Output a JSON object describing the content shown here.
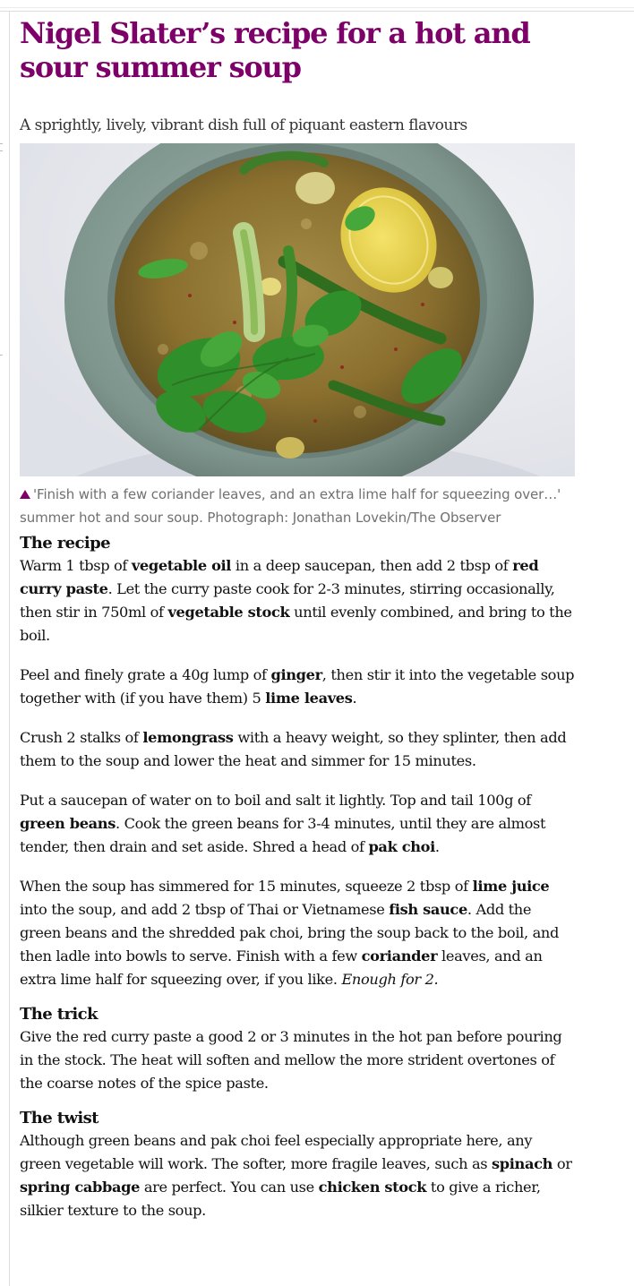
{
  "article": {
    "headline": "Nigel Slater’s recipe for a hot and sour summer soup",
    "standfirst": "A sprightly, lively, vibrant dish full of piquant eastern flavours",
    "image_alt": "Bowl of hot and sour summer soup with coriander, green beans, pak choi and lime half",
    "caption": "'Finish with a few coriander leaves, and an extra lime half for squeezing over…' summer hot and sour soup. Photograph: Jonathan Lovekin/The Observer"
  },
  "recipe": {
    "heading": "The recipe",
    "p1": {
      "t1": "Warm 1 tbsp of ",
      "b1": "vegetable oil",
      "t2": " in a deep saucepan, then add 2 tbsp of ",
      "b2": "red curry paste",
      "t3": ". Let the curry paste cook for 2-3 minutes, stirring occasionally, then stir in 750ml of ",
      "b3": "vegetable stock",
      "t4": " until evenly combined, and bring to the boil."
    },
    "p2": {
      "t1": "Peel and finely grate a 40g lump of ",
      "b1": "ginger",
      "t2": ", then stir it into the vegetable soup together with (if you have them) 5 ",
      "b2": "lime leaves",
      "t3": "."
    },
    "p3": {
      "t1": "Crush 2 stalks of ",
      "b1": "lemongrass",
      "t2": " with a heavy weight, so they splinter, then add them to the soup and lower the heat and simmer for 15 minutes."
    },
    "p4": {
      "t1": "Put a saucepan of water on to boil and salt it lightly. Top and tail 100g of ",
      "b1": "green beans",
      "t2": ". Cook the green beans for 3-4 minutes, until they are almost tender, then drain and set aside. Shred a head of ",
      "b2": "pak choi",
      "t3": "."
    },
    "p5": {
      "t1": "When the soup has simmered for 15 minutes, squeeze 2 tbsp of ",
      "b1": "lime juice",
      "t2": " into the soup, and add 2 tbsp of Thai or Vietnamese ",
      "b2": "fish sauce",
      "t3": ". Add the green beans and the shredded pak choi, bring the soup back to the boil, and then ladle into bowls to serve. Finish with a few ",
      "b3": "coriander",
      "t4": " leaves, and an extra lime half for squeezing over, if you like. ",
      "i1": "Enough for 2."
    }
  },
  "trick": {
    "heading": "The trick",
    "text": "Give the red curry paste a good 2 or 3 minutes in the hot pan before pouring in the stock. The heat will soften and mellow the more strident overtones of the coarse notes of the spice paste."
  },
  "twist": {
    "heading": "The twist",
    "t1": "Although green beans and pak choi feel especially appropriate here, any green vegetable will work. The softer, more fragile leaves, such as ",
    "b1": "spinach",
    "t2": " or ",
    "b2": "spring cabbage",
    "t3": " are perfect. You can use ",
    "b3": "chicken stock",
    "t4": " to give a richer, silkier texture to the soup."
  },
  "colors": {
    "headline": "#7d0068",
    "caption_triangle": "#7d0068",
    "body_text": "#121212",
    "caption_text": "#707070"
  },
  "icons": {
    "caption_marker": "triangle-up-icon"
  }
}
